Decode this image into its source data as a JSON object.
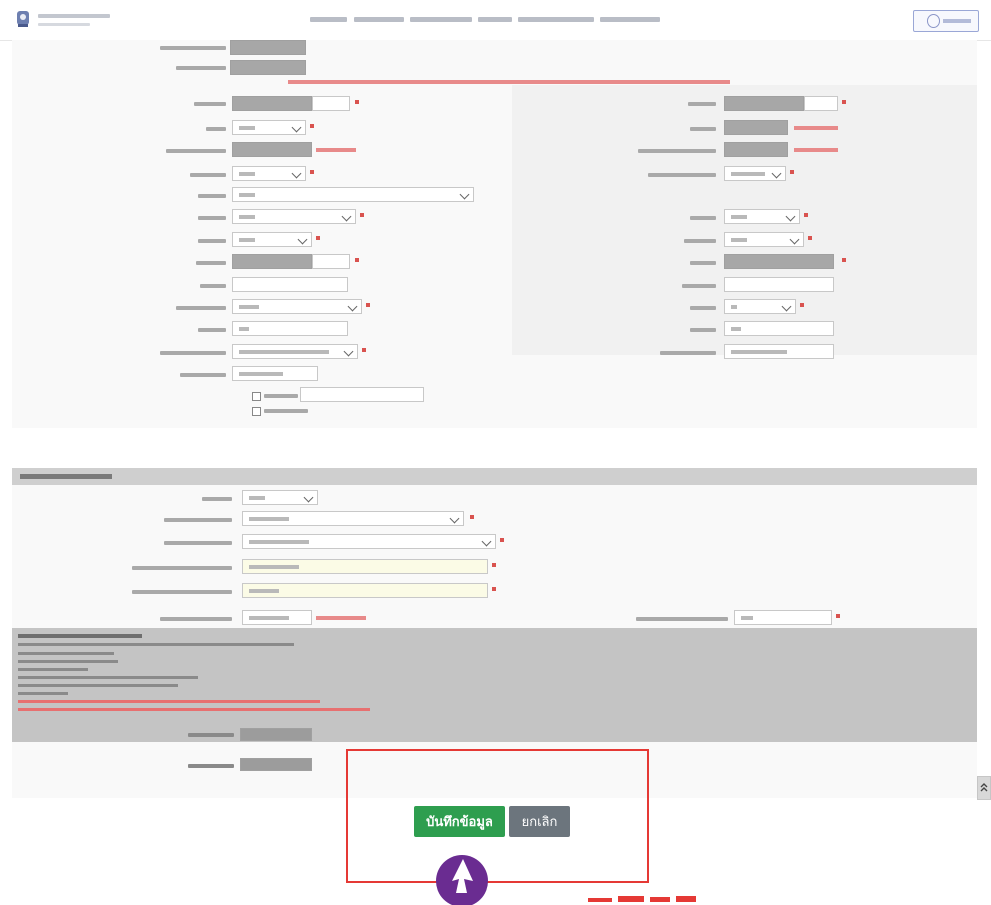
{
  "actions": {
    "save_label": "บันทึกข้อมูล",
    "cancel_label": "ยกเลิก"
  },
  "colors": {
    "save": "#2e9e4f",
    "cancel": "#6c757d",
    "highlight": "#e53935",
    "cursor": "#6a2c91",
    "section_header": "#cfcfcf",
    "masked_field": "#a7a7a7"
  },
  "icons": {
    "logo": "school-logo-icon",
    "login": "user-avatar-icon",
    "scroll_top": "double-chevron-up-icon",
    "pointer": "arrow-cursor-icon"
  }
}
